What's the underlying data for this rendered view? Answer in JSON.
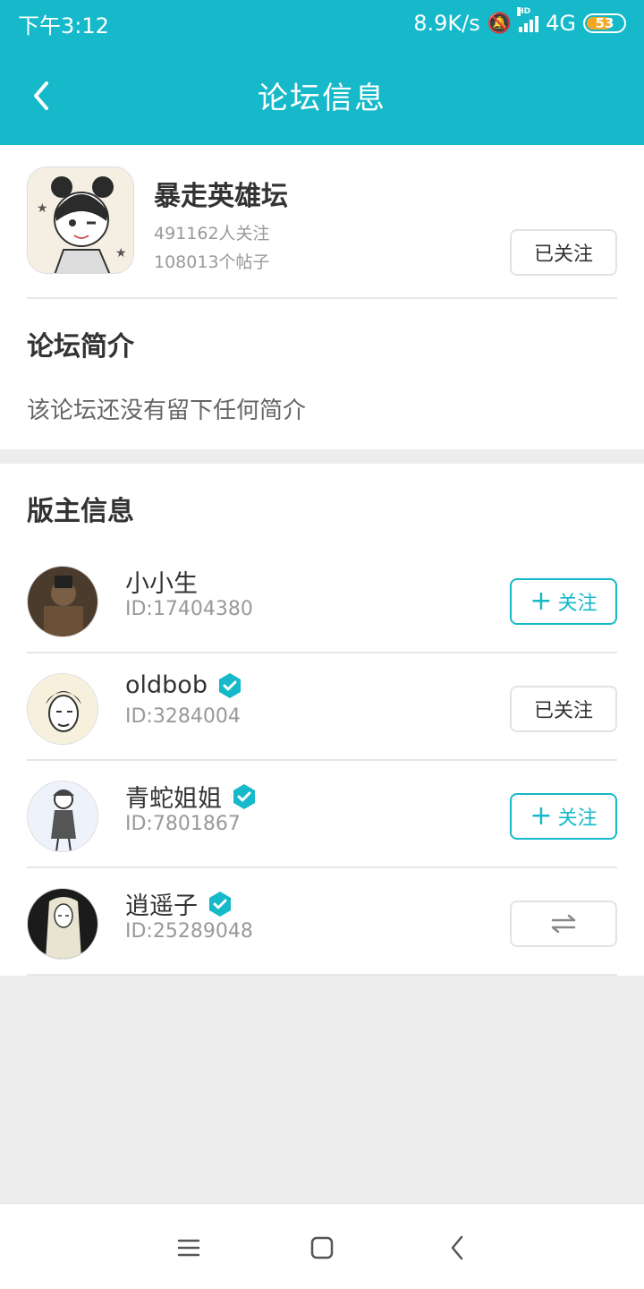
{
  "status": {
    "time": "下午3:12",
    "speed": "8.9K/s",
    "network": "4G",
    "network_hd": "HD",
    "battery": "53"
  },
  "header": {
    "title": "论坛信息"
  },
  "forum": {
    "name": "暴走英雄坛",
    "followers": "491162人关注",
    "posts": "108013个帖子",
    "follow_state": "已关注",
    "intro_title": "论坛简介",
    "intro_text": "该论坛还没有留下任何简介"
  },
  "moderators": {
    "title": "版主信息",
    "items": [
      {
        "name": "小小生",
        "id": "ID:17404380",
        "verified": false,
        "button": "关注",
        "button_state": "follow"
      },
      {
        "name": "oldbob",
        "id": "ID:3284004",
        "verified": true,
        "button": "已关注",
        "button_state": "following"
      },
      {
        "name": "青蛇姐姐",
        "id": "ID:7801867",
        "verified": true,
        "button": "关注",
        "button_state": "follow"
      },
      {
        "name": "逍遥子",
        "id": "ID:25289048",
        "verified": true,
        "button": "",
        "button_state": "mutual"
      }
    ]
  },
  "colors": {
    "accent": "#15b9c9",
    "background": "#ededed"
  }
}
